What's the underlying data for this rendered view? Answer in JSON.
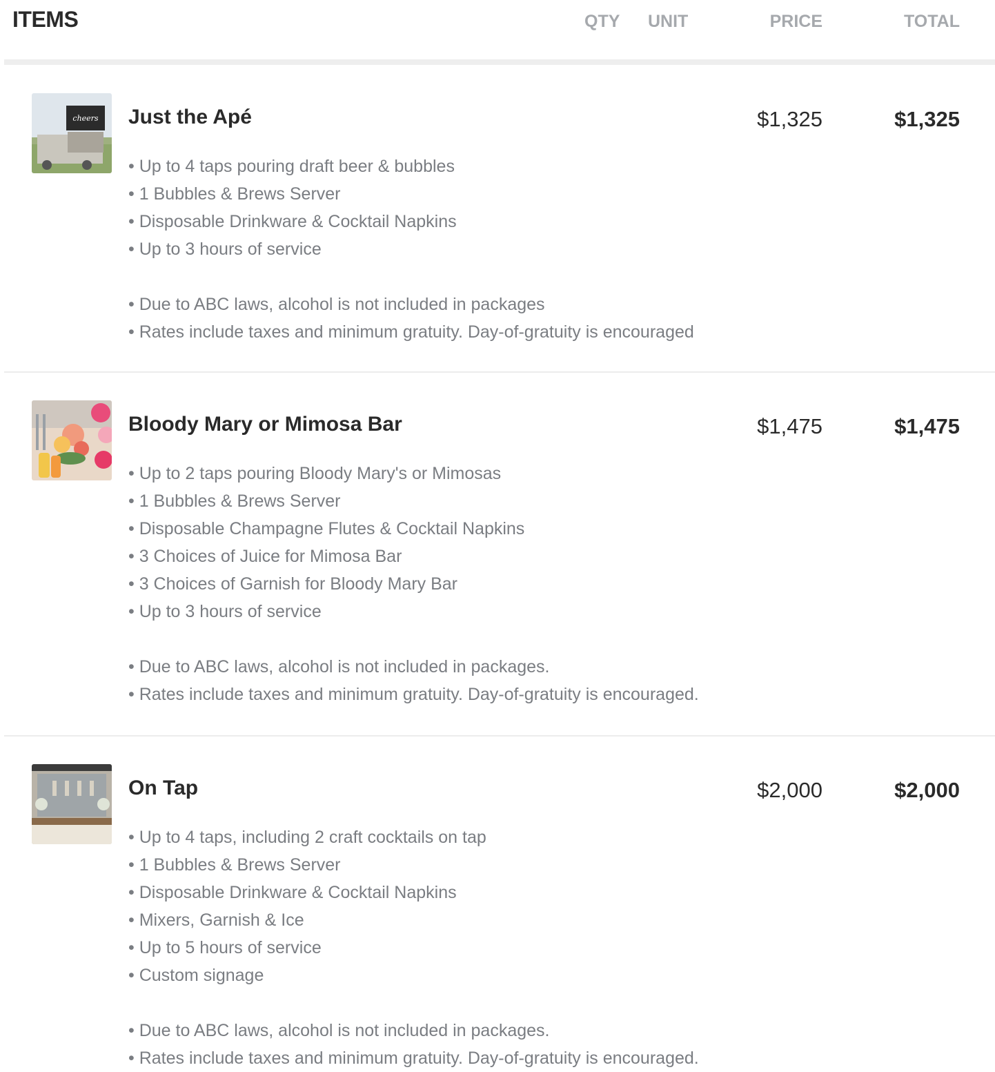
{
  "header": {
    "title": "ITEMS",
    "qty": "QTY",
    "unit": "UNIT",
    "price": "PRICE",
    "total": "TOTAL"
  },
  "items": [
    {
      "name": "Just the Apé",
      "price": "$1,325",
      "total": "$1,325",
      "features": [
        "Up to 4 taps pouring draft beer & bubbles",
        "1 Bubbles & Brews Server",
        "Disposable Drinkware & Cocktail Napkins",
        "Up to 3 hours of service"
      ],
      "notes": [
        "Due to ABC laws, alcohol is not included in packages",
        "Rates include taxes and minimum gratuity. Day-of-gratuity is encouraged"
      ],
      "thumb_text": "cheers"
    },
    {
      "name": "Bloody Mary or Mimosa Bar",
      "price": "$1,475",
      "total": "$1,475",
      "features": [
        "Up to 2 taps pouring Bloody Mary's or Mimosas",
        "1 Bubbles & Brews Server",
        "Disposable Champagne Flutes & Cocktail Napkins",
        "3 Choices of Juice for Mimosa Bar",
        "3 Choices of Garnish for Bloody Mary Bar",
        "Up to 3 hours of service"
      ],
      "notes": [
        "Due to ABC laws, alcohol is not included in packages.",
        "Rates include taxes and minimum gratuity. Day-of-gratuity is encouraged."
      ]
    },
    {
      "name": "On Tap",
      "price": "$2,000",
      "total": "$2,000",
      "features": [
        "Up to 4 taps, including 2 craft cocktails on tap",
        "1 Bubbles & Brews Server",
        "Disposable Drinkware & Cocktail Napkins",
        "Mixers, Garnish & Ice",
        "Up to 5 hours of service",
        "Custom signage"
      ],
      "notes": [
        "Due to ABC laws, alcohol is not included in packages.",
        "Rates include taxes and minimum gratuity. Day-of-gratuity is encouraged."
      ]
    }
  ],
  "colors": {
    "heading": "#2a2a2a",
    "header_label": "#a6a9ad",
    "description": "#7a7d82",
    "divider": "#ececec"
  },
  "icons": [
    "truck-photo",
    "mimosa-bar-photo",
    "tap-wall-photo"
  ]
}
